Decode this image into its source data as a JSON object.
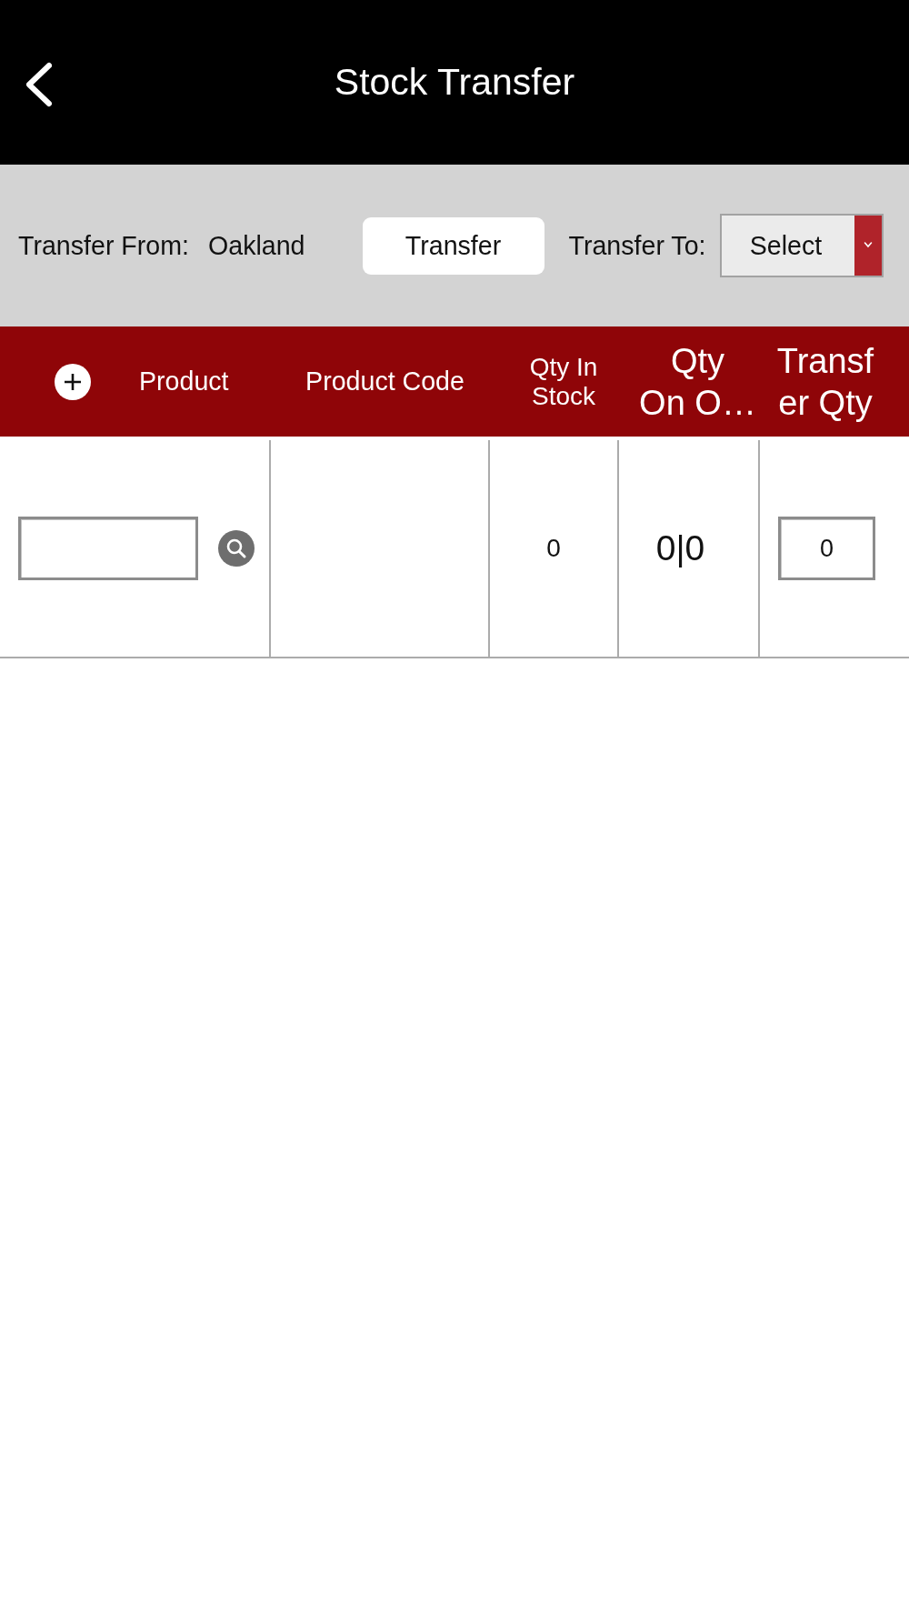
{
  "title_bar": {
    "title": "Stock Transfer"
  },
  "transfer_bar": {
    "from_label": "Transfer From:",
    "from_value": "Oakland",
    "button": "Transfer",
    "to_label": "Transfer To:",
    "to_select": {
      "value": "Select"
    }
  },
  "table": {
    "columns": [
      {
        "label": "Product"
      },
      {
        "label": "Product Code"
      },
      {
        "label": "Qty In\nStock"
      },
      {
        "label": "Qty\nOn O…"
      },
      {
        "label": "Transf\ner Qty"
      }
    ],
    "rows": [
      {
        "cells": [
          {
            "kind": "search_field"
          },
          {
            "kind": "blank"
          },
          {
            "kind": "text",
            "text": "0"
          },
          {
            "kind": "text",
            "text": "0|0"
          },
          {
            "kind": "input",
            "value": "0"
          }
        ]
      }
    ]
  }
}
